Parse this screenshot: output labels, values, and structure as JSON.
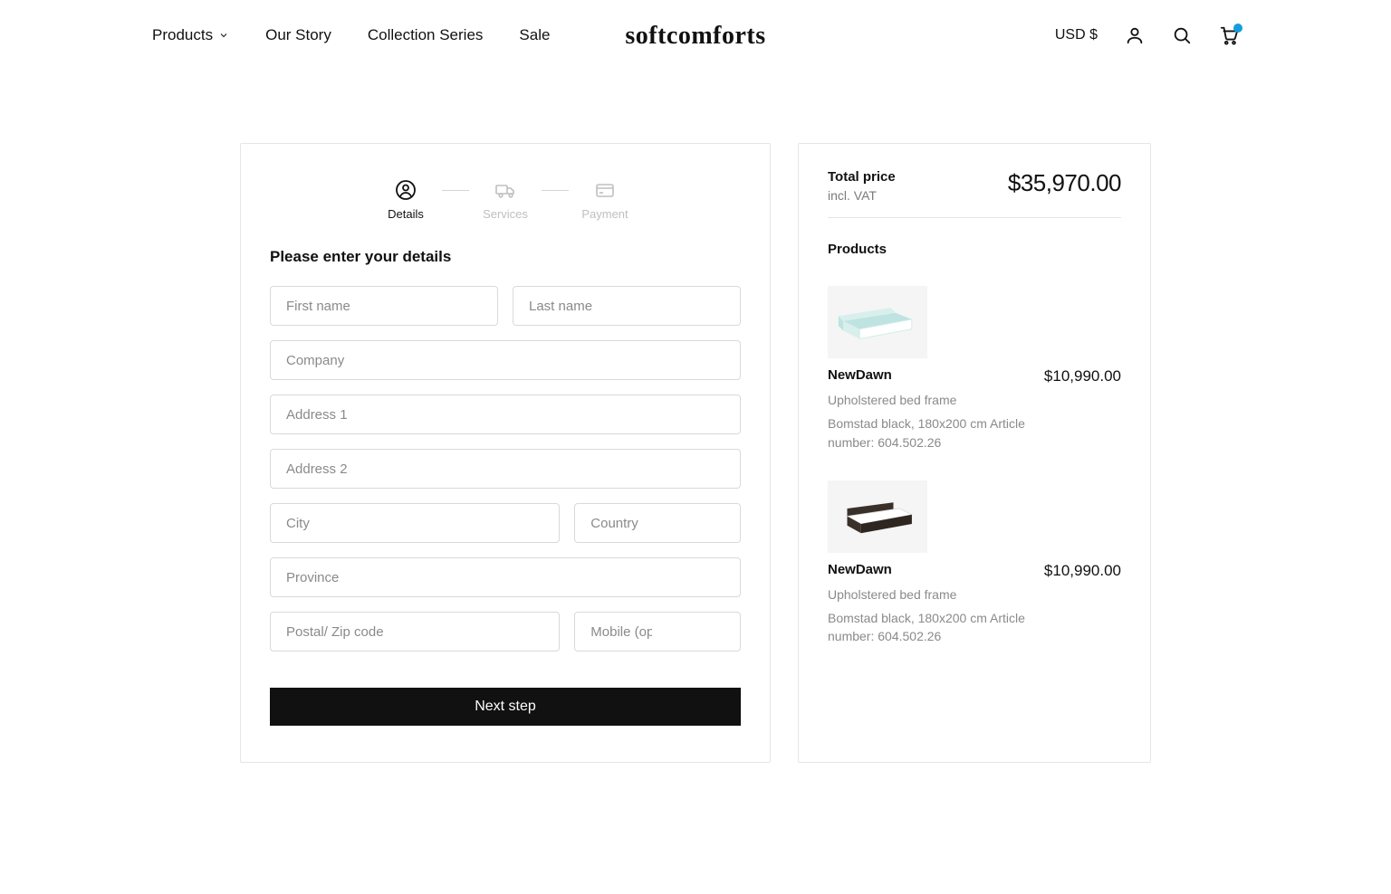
{
  "brand": "softcomforts",
  "nav": {
    "products": "Products",
    "story": "Our Story",
    "collection": "Collection Series",
    "sale": "Sale"
  },
  "currency": "USD $",
  "stepper": {
    "details": "Details",
    "services": "Services",
    "payment": "Payment"
  },
  "form": {
    "title": "Please enter your details",
    "placeholders": {
      "first_name": "First name",
      "last_name": "Last name",
      "company": "Company",
      "address1": "Address 1",
      "address2": "Address 2",
      "city": "City",
      "country": "Country",
      "province": "Province",
      "postal": "Postal/ Zip code",
      "mobile": "Mobile (optional)"
    },
    "next": "Next step"
  },
  "summary": {
    "total_label": "Total price",
    "total_sub": "incl. VAT",
    "total_amount": "$35,970.00",
    "products_title": "Products",
    "items": [
      {
        "name": "NewDawn",
        "price": "$10,990.00",
        "subtitle": "Upholstered bed frame",
        "detail": "Bomstad black, 180x200 cm Article number: 604.502.26"
      },
      {
        "name": "NewDawn",
        "price": "$10,990.00",
        "subtitle": "Upholstered bed frame",
        "detail": "Bomstad black, 180x200 cm Article number: 604.502.26"
      }
    ]
  }
}
